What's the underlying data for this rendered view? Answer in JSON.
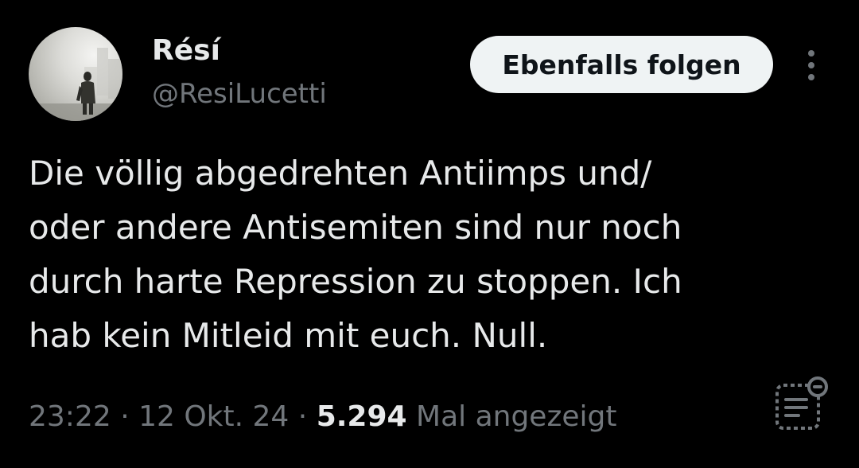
{
  "author": {
    "display_name": "Résí",
    "handle": "@ResiLucetti"
  },
  "actions": {
    "follow_label": "Ebenfalls folgen",
    "more_icon": "more-vertical-icon",
    "summary_icon": "summary-icon"
  },
  "tweet": {
    "lines": [
      "Die völlig abgedrehten Antiimps und/",
      "oder andere Antisemiten sind nur noch",
      "durch harte Repression zu stoppen. Ich",
      "hab kein Mitleid mit euch. Null."
    ]
  },
  "meta": {
    "time": "23:22",
    "separator": " · ",
    "date": "12 Okt. 24",
    "views_count": "5.294",
    "views_label": "Mal angezeigt"
  },
  "colors": {
    "background": "#000000",
    "primary_text": "#e7e9ea",
    "secondary_text": "#71767b",
    "button_bg": "#eff3f4",
    "button_text": "#0f1419"
  }
}
